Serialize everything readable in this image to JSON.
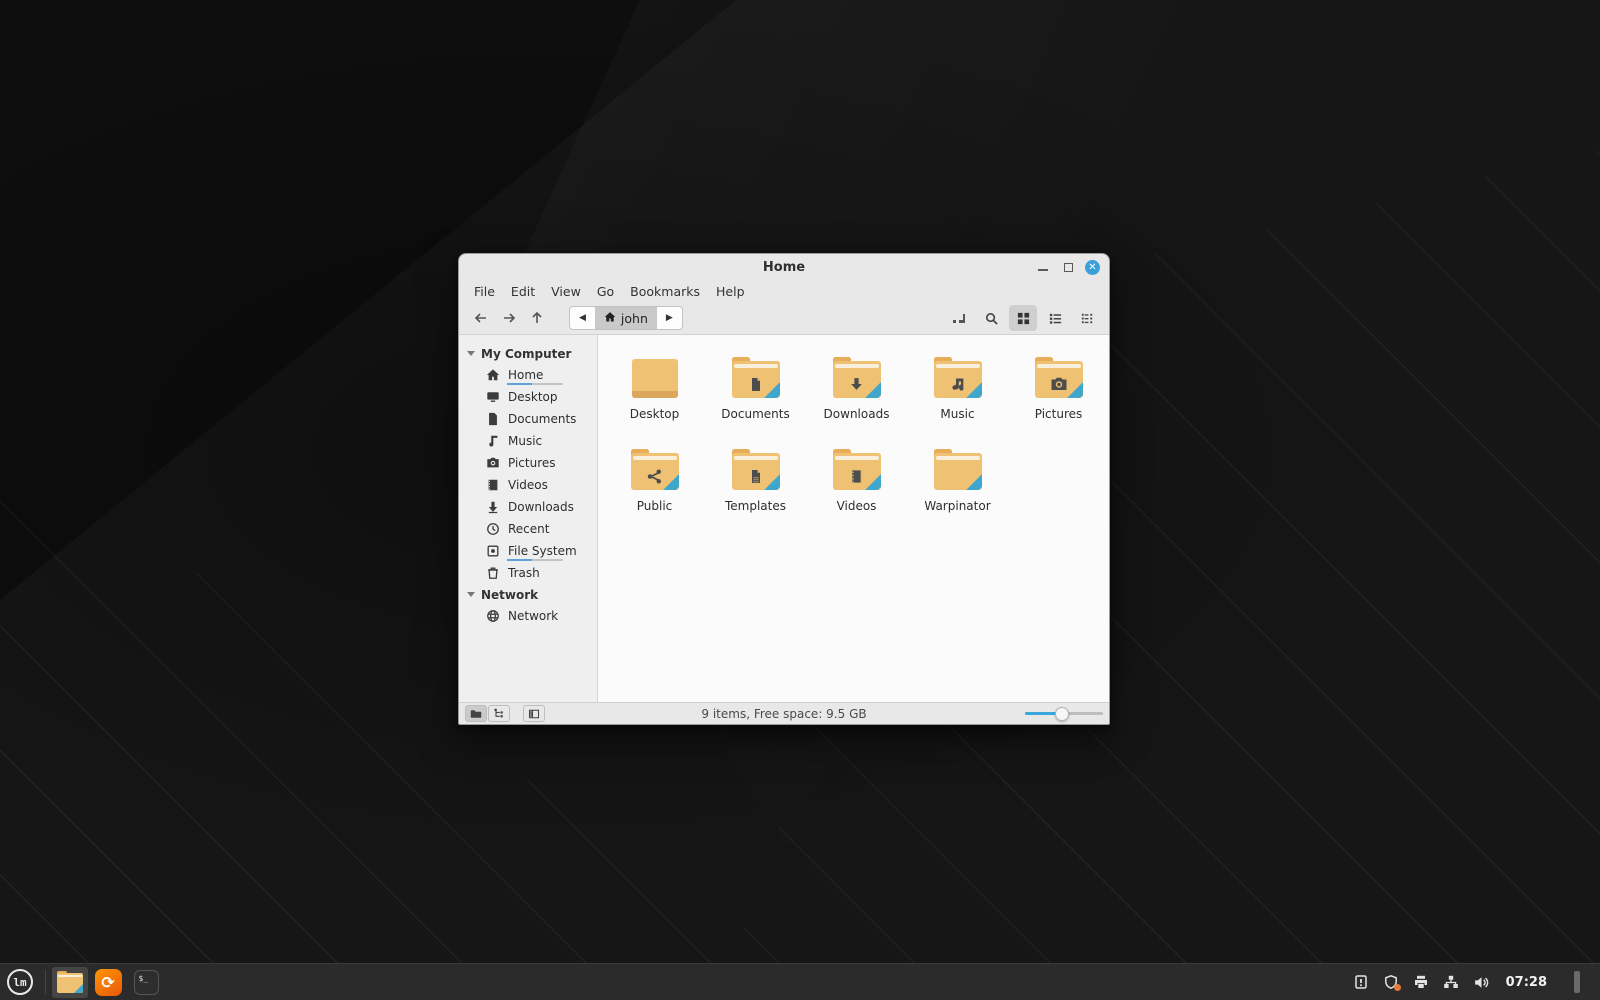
{
  "window": {
    "title": "Home",
    "controls": {
      "minimize": "minimize",
      "maximize": "maximize",
      "close": "close"
    },
    "menu": [
      "File",
      "Edit",
      "View",
      "Go",
      "Bookmarks",
      "Help"
    ],
    "toolbar": {
      "nav": [
        "back",
        "forward",
        "up"
      ],
      "breadcrumb": {
        "current": "john",
        "prev_arrow": "left",
        "next_arrow": "right"
      },
      "right_icons": [
        "location-entry-toggle",
        "search",
        "grid-view",
        "list-view",
        "compact-view"
      ],
      "active_view": "grid-view"
    },
    "sidebar": {
      "sections": [
        {
          "label": "My Computer",
          "items": [
            {
              "label": "Home",
              "icon": "home-icon",
              "selected": true,
              "usage_percent": 45
            },
            {
              "label": "Desktop",
              "icon": "desktop-icon"
            },
            {
              "label": "Documents",
              "icon": "documents-icon"
            },
            {
              "label": "Music",
              "icon": "music-icon"
            },
            {
              "label": "Pictures",
              "icon": "pictures-icon"
            },
            {
              "label": "Videos",
              "icon": "videos-icon"
            },
            {
              "label": "Downloads",
              "icon": "downloads-icon"
            },
            {
              "label": "Recent",
              "icon": "recent-icon"
            },
            {
              "label": "File System",
              "icon": "filesystem-icon",
              "usage_percent": 45
            },
            {
              "label": "Trash",
              "icon": "trash-icon"
            }
          ]
        },
        {
          "label": "Network",
          "items": [
            {
              "label": "Network",
              "icon": "network-icon"
            }
          ]
        }
      ]
    },
    "files": [
      {
        "label": "Desktop",
        "icon": "desktop-folder"
      },
      {
        "label": "Documents",
        "icon": "documents-folder"
      },
      {
        "label": "Downloads",
        "icon": "downloads-folder"
      },
      {
        "label": "Music",
        "icon": "music-folder"
      },
      {
        "label": "Pictures",
        "icon": "pictures-folder"
      },
      {
        "label": "Public",
        "icon": "public-folder"
      },
      {
        "label": "Templates",
        "icon": "templates-folder"
      },
      {
        "label": "Videos",
        "icon": "videos-folder"
      },
      {
        "label": "Warpinator",
        "icon": "plain-folder"
      }
    ],
    "statusbar": {
      "text": "9 items, Free space: 9.5 GB",
      "left_buttons": [
        "places-toggle",
        "treeview-toggle",
        "sidebar-toggle"
      ],
      "active_button": "places-toggle",
      "zoom_percent": 48
    }
  },
  "taskbar": {
    "launcher": "mint-menu",
    "mint_logo_text": "lm",
    "apps": [
      {
        "name": "file-manager",
        "icon": "folder-icon",
        "active": true
      },
      {
        "name": "firefox",
        "icon": "firefox-icon"
      },
      {
        "name": "terminal",
        "icon": "terminal-icon"
      }
    ],
    "tray_icons": [
      "report-icon",
      "shield-update-icon",
      "printer-icon",
      "network-tray-icon",
      "volume-icon"
    ],
    "clock": "07:28"
  },
  "colors": {
    "accent_blue": "#3aa7dc",
    "close_button": "#3ba0d9",
    "folder_body": "#efc173",
    "folder_tab": "#e7ad58",
    "folder_stripe": "#3fa7cd",
    "window_chrome": "#e8e8e8",
    "sidebar_bg": "#efefef",
    "view_bg": "#fbfbfb",
    "taskbar_bg": "#2b2b2b",
    "firefox_orange": "#e8590c"
  }
}
